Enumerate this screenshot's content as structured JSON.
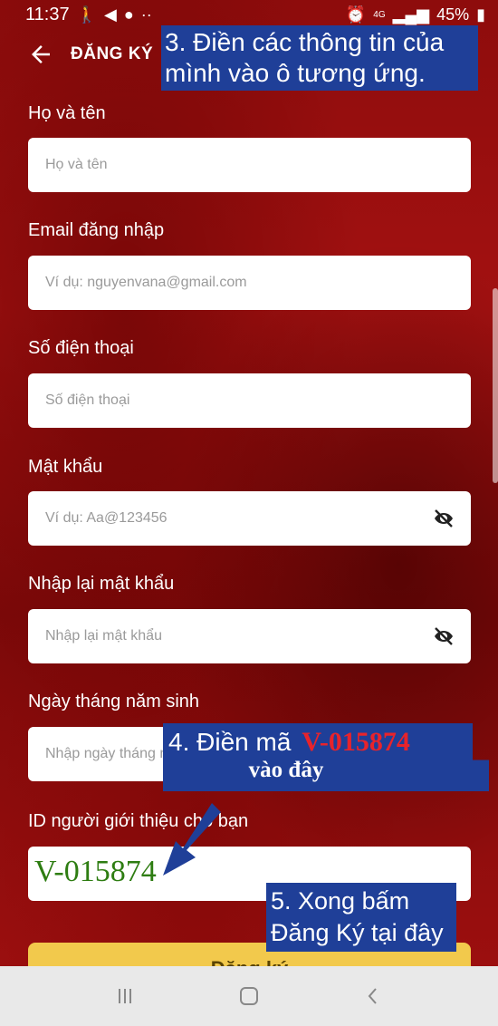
{
  "status_bar": {
    "time": "11:37",
    "battery": "45%",
    "network": "4G"
  },
  "app_bar": {
    "title": "ĐĂNG KÝ"
  },
  "form": {
    "full_name": {
      "label": "Họ và tên",
      "placeholder": "Họ và tên"
    },
    "email": {
      "label": "Email đăng nhập",
      "placeholder": "Ví dụ: nguyenvana@gmail.com"
    },
    "phone": {
      "label": "Số điện thoại",
      "placeholder": "Số điện thoại"
    },
    "password": {
      "label": "Mật khẩu",
      "placeholder": "Ví dụ: Aa@123456"
    },
    "confirm_password": {
      "label": "Nhập lại mật khẩu",
      "placeholder": "Nhập lại mật khẩu"
    },
    "birthday": {
      "label": "Ngày tháng năm sinh",
      "placeholder": "Nhập ngày tháng năm sinh"
    },
    "referral": {
      "label": "ID người giới thiệu cho bạn",
      "value": "V-015874"
    },
    "submit_label": "Đăng ký"
  },
  "annotations": {
    "step3_line1": "3. Điền các thông tin của",
    "step3_line2": "mình vào ô tương ứng.",
    "step4_prefix": "4. Điền mã",
    "step4_code": "V-015874",
    "step4_suffix": "vào đây",
    "step5_line1": "5. Xong bấm",
    "step5_line2": "Đăng Ký tại đây"
  },
  "colors": {
    "annotation_bg": "#1f3f98",
    "code_red": "#e8232b",
    "code_green": "#2e7d12",
    "button_yellow": "#f2c94c"
  }
}
